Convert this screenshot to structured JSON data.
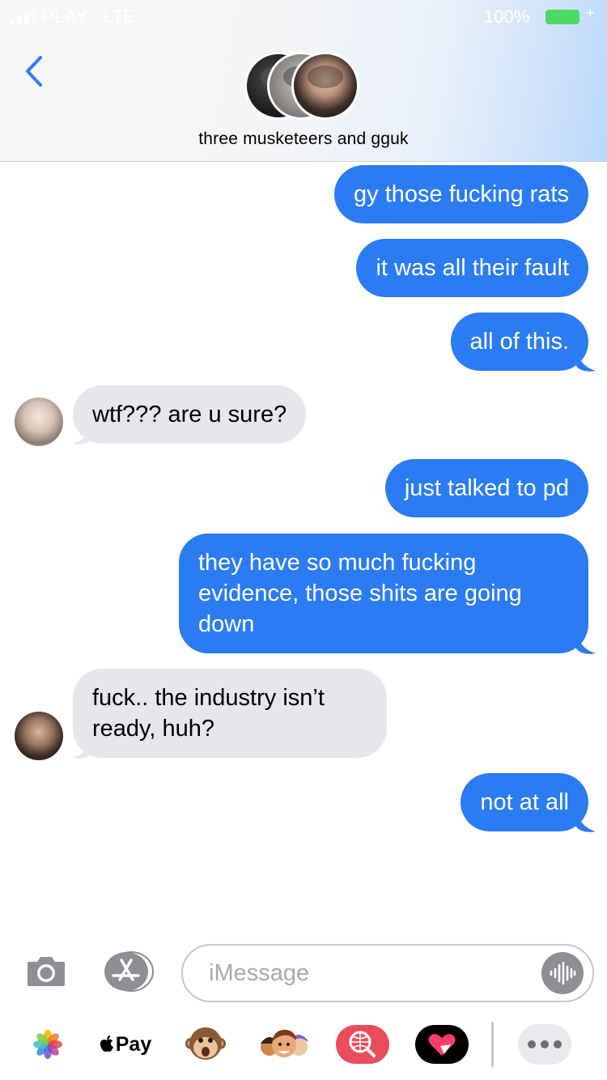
{
  "status_bar": {
    "carrier": "PLAY",
    "network": "LTE",
    "battery_percent": "100%"
  },
  "header": {
    "group_name": "three musketeers and gguk"
  },
  "messages": [
    {
      "direction": "sent",
      "text": "gy those fucking rats"
    },
    {
      "direction": "sent",
      "text": "it was all their fault"
    },
    {
      "direction": "sent",
      "text": "all of this."
    },
    {
      "direction": "received",
      "text": "wtf??? are u sure?"
    },
    {
      "direction": "sent",
      "text": "just talked to pd"
    },
    {
      "direction": "sent",
      "text": "they have so much fucking evidence, those shits are going down"
    },
    {
      "direction": "received",
      "text": "fuck.. the industry isn’t ready, huh?"
    },
    {
      "direction": "sent",
      "text": "not at all"
    }
  ],
  "input": {
    "placeholder": "iMessage",
    "value": ""
  },
  "app_drawer": {
    "apple_pay_label": "Pay",
    "items": [
      "photos-icon",
      "apple-pay",
      "animoji-monkey-icon",
      "memoji-icon",
      "web-search-icon",
      "digital-touch-icon"
    ]
  },
  "colors": {
    "sent_bubble": "#2b7cf3",
    "received_bubble": "#e6e6eb",
    "accent": "#2f7bf5"
  }
}
